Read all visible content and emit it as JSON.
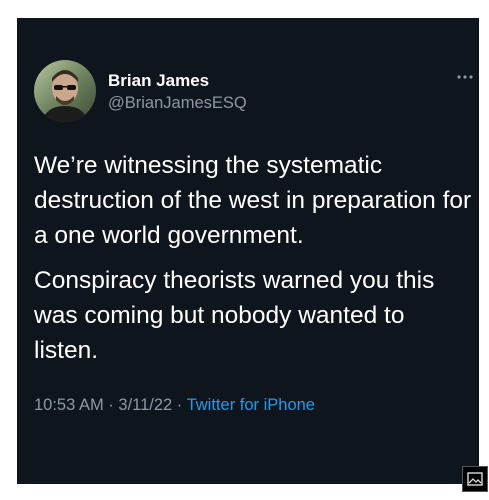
{
  "tweet": {
    "display_name": "Brian James",
    "handle": "@BrianJamesESQ",
    "paragraphs": [
      "We’re witnessing the systematic destruction of the west in preparation for a one world government.",
      "Conspiracy theorists warned you this was coming but nobody wanted to listen."
    ],
    "time": "10:53 AM",
    "date": "3/11/22",
    "source": "Twitter for iPhone",
    "separator": " · "
  },
  "icons": {
    "more": "more-icon",
    "media": "image-icon"
  },
  "colors": {
    "background": "#0f151c",
    "text": "#ffffff",
    "muted": "#8b98a5",
    "link": "#1d9bf0"
  }
}
